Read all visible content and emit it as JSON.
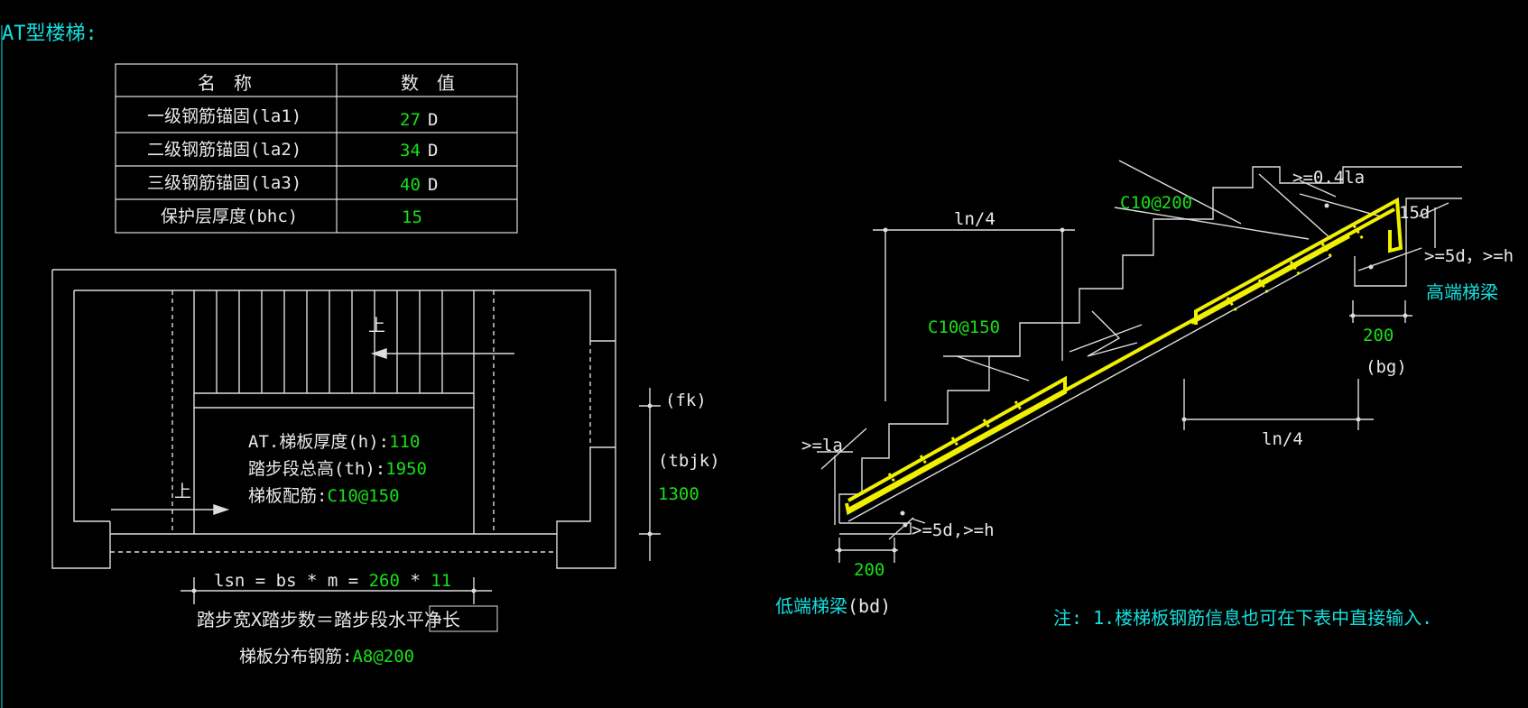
{
  "title": "AT型楼梯:",
  "table": {
    "headers": [
      "名　称",
      "数　值"
    ],
    "rows": [
      {
        "name": "一级钢筋锚固(la1)",
        "value": "27",
        "unit": "D"
      },
      {
        "name": "二级钢筋锚固(la2)",
        "value": "34",
        "unit": "D"
      },
      {
        "name": "三级钢筋锚固(la3)",
        "value": "40",
        "unit": "D"
      },
      {
        "name": "保护层厚度(bhc)",
        "value": "15",
        "unit": ""
      }
    ]
  },
  "plan": {
    "up_label_1": "上",
    "up_label_2": "上",
    "thickness_label": "AT.梯板厚度(h):",
    "thickness_value": "110",
    "height_label": "踏步段总高(th):",
    "height_value": "1950",
    "rebar_label": "梯板配筋:",
    "rebar_value": "C10@150",
    "fk": "(fk)",
    "tbjk": "(tbjk)",
    "width_value": "1300",
    "lsn_label": "lsn = bs * m =",
    "bs_value": "260",
    "times": "*",
    "m_value": "11",
    "formula_text": "踏步宽X踏步数＝踏步段水平净长",
    "dist_label": "梯板分布钢筋:",
    "dist_value": "A8@200"
  },
  "section": {
    "ln4_top": "ln/4",
    "ln4_bottom": "ln/4",
    "c10_200": "C10@200",
    "c10_150": "C10@150",
    "ge_04la": ">=0.4la",
    "d15": "15d",
    "ge_5d_h_top": ">=5d，>=h",
    "high_beam": "高端梯梁",
    "dim200_top": "200",
    "bg": "(bg)",
    "ge_la": ">=la",
    "ge_5d_h_bottom": ">=5d,>=h",
    "dim200_bottom": "200",
    "low_beam": "低端梯梁",
    "bd": "(bd)"
  },
  "note": "注: 1.楼梯板钢筋信息也可在下表中直接输入.",
  "colors": {
    "background": "#000000",
    "cyan": "#14e0e0",
    "green": "#18e018",
    "yellow": "#f0f000",
    "line": "#ffffff"
  }
}
